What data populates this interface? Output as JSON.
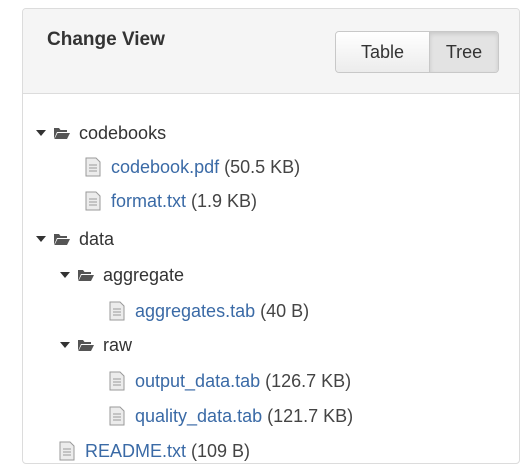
{
  "panel": {
    "title": "Change View",
    "view_options": {
      "table_label": "Table",
      "tree_label": "Tree",
      "selected": "Tree"
    }
  },
  "tree": {
    "codebooks": {
      "name": "codebooks"
    },
    "codebook_pdf": {
      "name": "codebook.pdf",
      "size": "(50.5 KB)"
    },
    "format_txt": {
      "name": "format.txt",
      "size": "(1.9 KB)"
    },
    "data": {
      "name": "data"
    },
    "aggregate": {
      "name": "aggregate"
    },
    "aggregates_tab": {
      "name": "aggregates.tab",
      "size": "(40 B)"
    },
    "raw": {
      "name": "raw"
    },
    "output_data_tab": {
      "name": "output_data.tab",
      "size": "(126.7 KB)"
    },
    "quality_data_tab": {
      "name": "quality_data.tab",
      "size": "(121.7 KB)"
    },
    "readme_txt": {
      "name": "README.txt",
      "size": "(109 B)"
    }
  },
  "colors": {
    "link": "#3a6aa6",
    "header_bg": "#f5f5f5",
    "border": "#dcdcdc"
  },
  "icons": {
    "caret": "caret-down-icon",
    "folder": "folder-open-icon",
    "file": "file-icon"
  }
}
